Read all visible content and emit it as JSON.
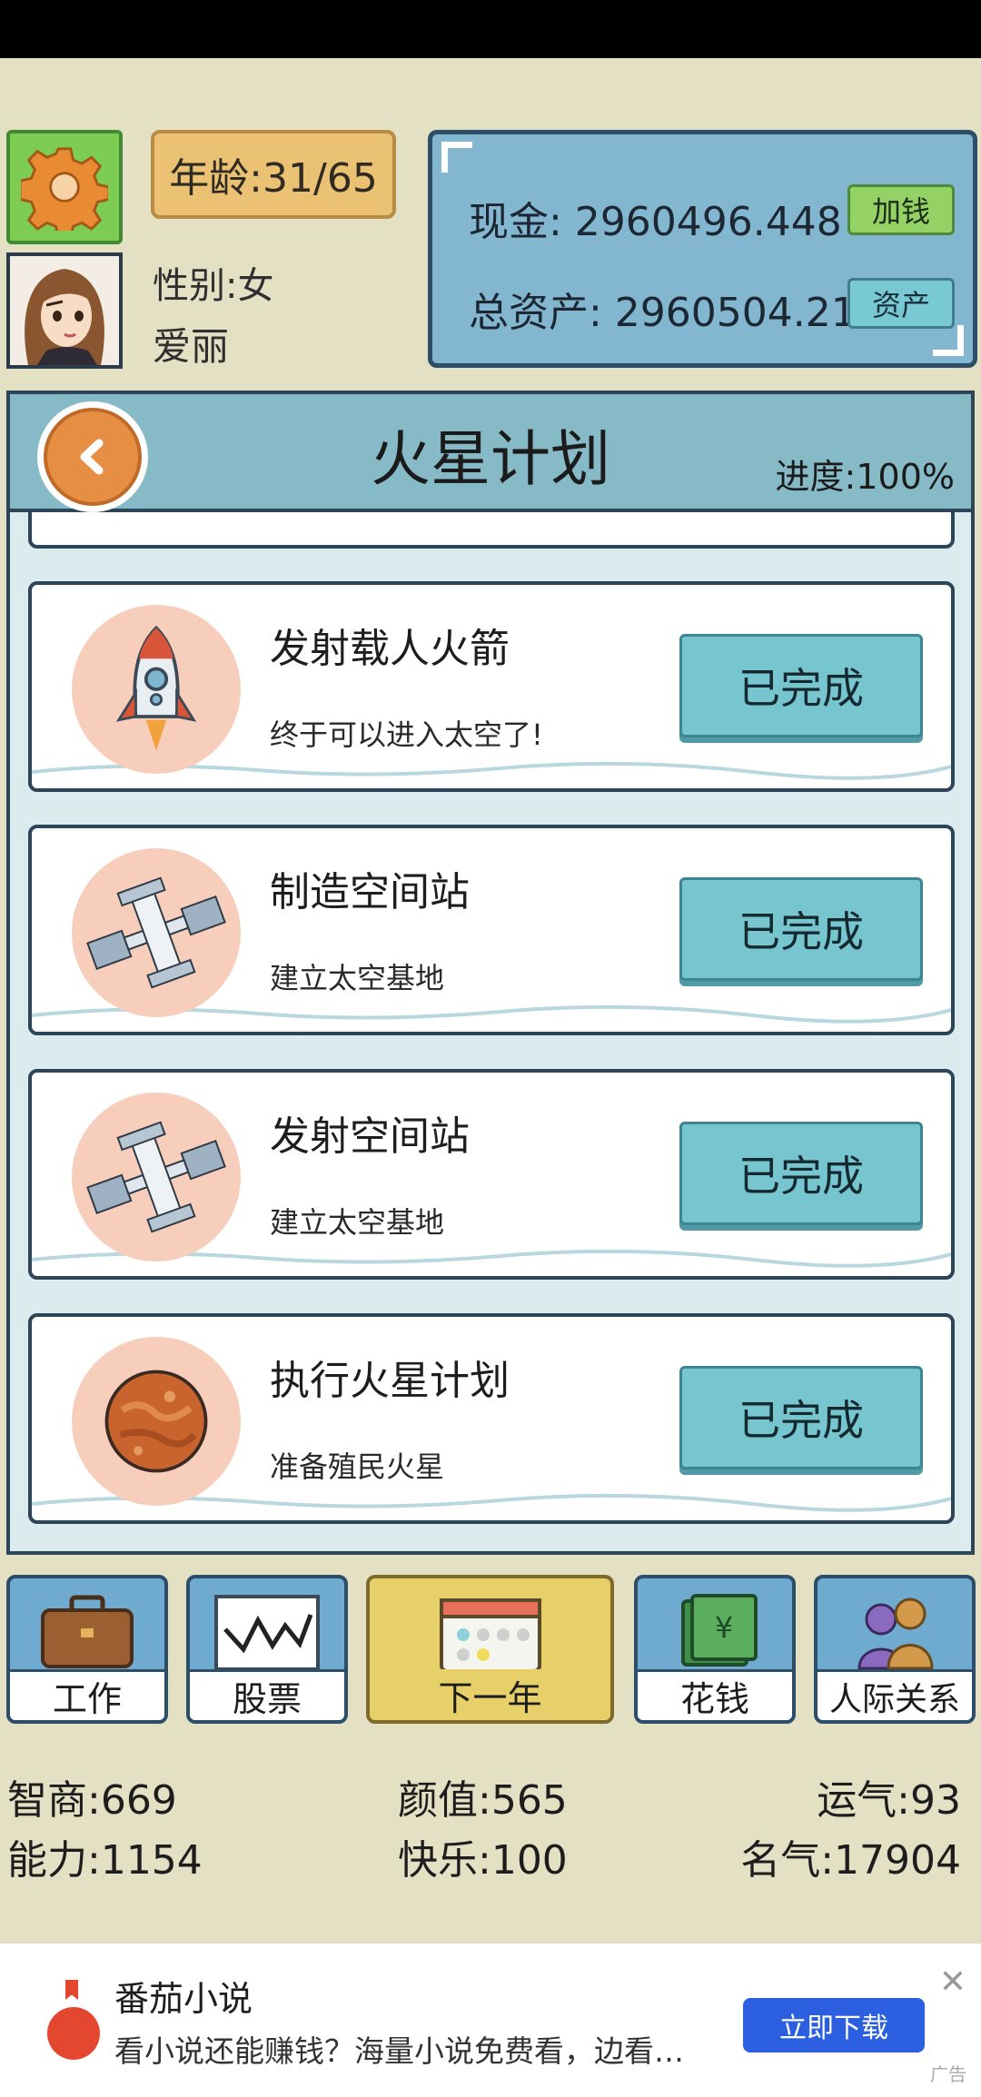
{
  "profile": {
    "age_label": "年龄:31/65",
    "gender_label": "性别:女",
    "name": "爱丽"
  },
  "finance": {
    "cash_label": "现金: 2960496.448",
    "add_money_label": "加钱",
    "assets_label": "总资产: 2960504.21",
    "assets_button_label": "资产"
  },
  "plan": {
    "title": "火星计划",
    "progress_label": "进度:100%",
    "items": [
      {
        "title": "发射载人火箭",
        "description": "终于可以进入太空了!",
        "status": "已完成",
        "icon": "rocket-icon"
      },
      {
        "title": "制造空间站",
        "description": "建立太空基地",
        "status": "已完成",
        "icon": "space-station-icon"
      },
      {
        "title": "发射空间站",
        "description": "建立太空基地",
        "status": "已完成",
        "icon": "space-station-icon"
      },
      {
        "title": "执行火星计划",
        "description": "准备殖民火星",
        "status": "已完成",
        "icon": "mars-icon"
      }
    ]
  },
  "nav": {
    "work": "工作",
    "stocks": "股票",
    "next_year": "下一年",
    "spend": "花钱",
    "relations": "人际关系"
  },
  "stats": {
    "iq": "智商:669",
    "looks": "颜值:565",
    "luck": "运气:93",
    "ability": "能力:1154",
    "happiness": "快乐:100",
    "fame": "名气:17904"
  },
  "ad": {
    "title": "番茄小说",
    "description": "看小说还能赚钱？海量小说免费看，边看…",
    "button": "立即下载",
    "close": "✕",
    "tag": "广告"
  },
  "colors": {
    "background": "#e3e0c4",
    "panel_blue": "#82b7cf",
    "done_button": "#77c6cf",
    "next_year": "#e7cf6a"
  }
}
